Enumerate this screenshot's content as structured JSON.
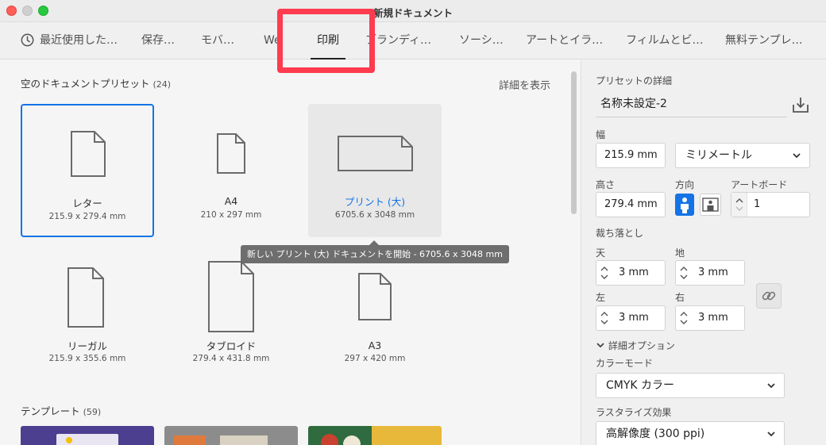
{
  "window": {
    "title": "新規ドキュメント"
  },
  "tabs": [
    {
      "label": "最近使用した…"
    },
    {
      "label": "保存…"
    },
    {
      "label": "モバ…"
    },
    {
      "label": "We"
    },
    {
      "label": "印刷",
      "active": true
    },
    {
      "label": "ブランディ…"
    },
    {
      "label": "ソーシ…"
    },
    {
      "label": "アートとイラ…"
    },
    {
      "label": "フィルムとビ…"
    },
    {
      "label": "無料テンプレ…"
    }
  ],
  "presets_section": {
    "title": "空のドキュメントプリセット",
    "count": "(24)",
    "details_link": "詳細を表示"
  },
  "presets": [
    {
      "name": "レター",
      "size": "215.9 x 279.4 mm",
      "state": "selected"
    },
    {
      "name": "A4",
      "size": "210 x 297 mm",
      "state": "normal"
    },
    {
      "name": "プリント (大)",
      "size": "6705.6 x 3048 mm",
      "state": "hovered"
    },
    {
      "name": "リーガル",
      "size": "215.9 x 355.6 mm",
      "state": "normal"
    },
    {
      "name": "タブロイド",
      "size": "279.4 x 431.8 mm",
      "state": "normal"
    },
    {
      "name": "A3",
      "size": "297 x 420 mm",
      "state": "normal"
    }
  ],
  "tooltip": "新しい プリント (大) ドキュメントを開始 - 6705.6 x 3048 mm",
  "templates_section": {
    "title": "テンプレート",
    "count": "(59)"
  },
  "panel": {
    "title": "プリセットの詳細",
    "doc_name": "名称未設定-2",
    "width_label": "幅",
    "width_value": "215.9 mm",
    "unit_value": "ミリメートル",
    "height_label": "高さ",
    "height_value": "279.4 mm",
    "orientation_label": "方向",
    "artboard_label": "アートボード",
    "artboard_value": "1",
    "bleed_label": "裁ち落とし",
    "bleed_top_label": "天",
    "bleed_top_value": "3 mm",
    "bleed_bottom_label": "地",
    "bleed_bottom_value": "3 mm",
    "bleed_left_label": "左",
    "bleed_left_value": "3 mm",
    "bleed_right_label": "右",
    "bleed_right_value": "3 mm",
    "advanced_label": "詳細オプション",
    "color_mode_label": "カラーモード",
    "color_mode_value": "CMYK カラー",
    "raster_label": "ラスタライズ効果",
    "raster_value": "高解像度 (300 ppi)"
  },
  "colors": {
    "accent": "#1473e6",
    "highlight": "#ff3b4f"
  }
}
